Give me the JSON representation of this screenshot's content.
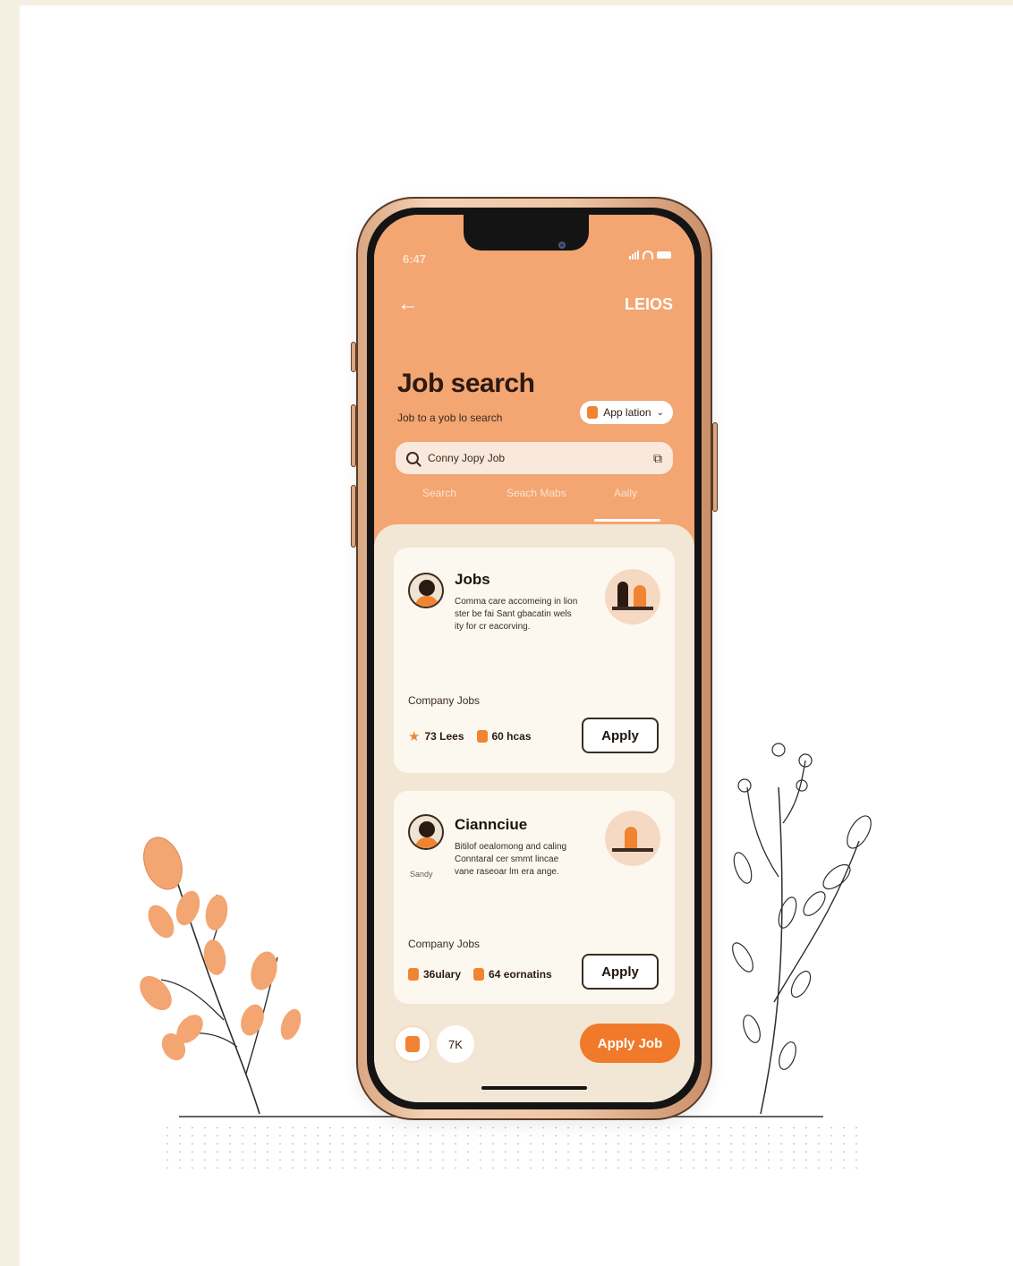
{
  "status_bar": {
    "time": "6:47"
  },
  "header": {
    "top_right": "LEIOS",
    "title": "Job search",
    "subtitle": "Job to a yob lo search",
    "app_pill": "App lation"
  },
  "search": {
    "value": "Conny Jopy Job",
    "placeholder": ""
  },
  "tabs": [
    {
      "label": "Search"
    },
    {
      "label": "Seach Mabs"
    },
    {
      "label": "Aally"
    }
  ],
  "cards": [
    {
      "title": "Jobs",
      "description": "Comma care accomeing in lion ster be fai Sant gbacatin wels ity for cr eacorving.",
      "subtitle": "Company Jobs",
      "meta1": "73 Lees",
      "meta2": "60 hcas",
      "button": "Apply"
    },
    {
      "title": "Ciannciue",
      "description": "Bitilof oealomong and caling Conntaral cer smmt lincae vane raseoar lm era ange.",
      "avatar_label": "Sandy",
      "subtitle": "Company Jobs",
      "meta1": "36ulary",
      "meta2": "64 eornatins",
      "button": "Apply"
    }
  ],
  "bottom": {
    "circle_2": "7K",
    "cta": "Apply Job"
  },
  "colors": {
    "accent": "#f3a572",
    "cta": "#f07a2a",
    "card": "#fdf8ef",
    "background": "#f2e7d4"
  },
  "icons": [
    "back-arrow-icon",
    "search-icon",
    "filter-icon",
    "star-icon",
    "badge-icon",
    "signal-icon",
    "wifi-icon",
    "battery-icon"
  ]
}
